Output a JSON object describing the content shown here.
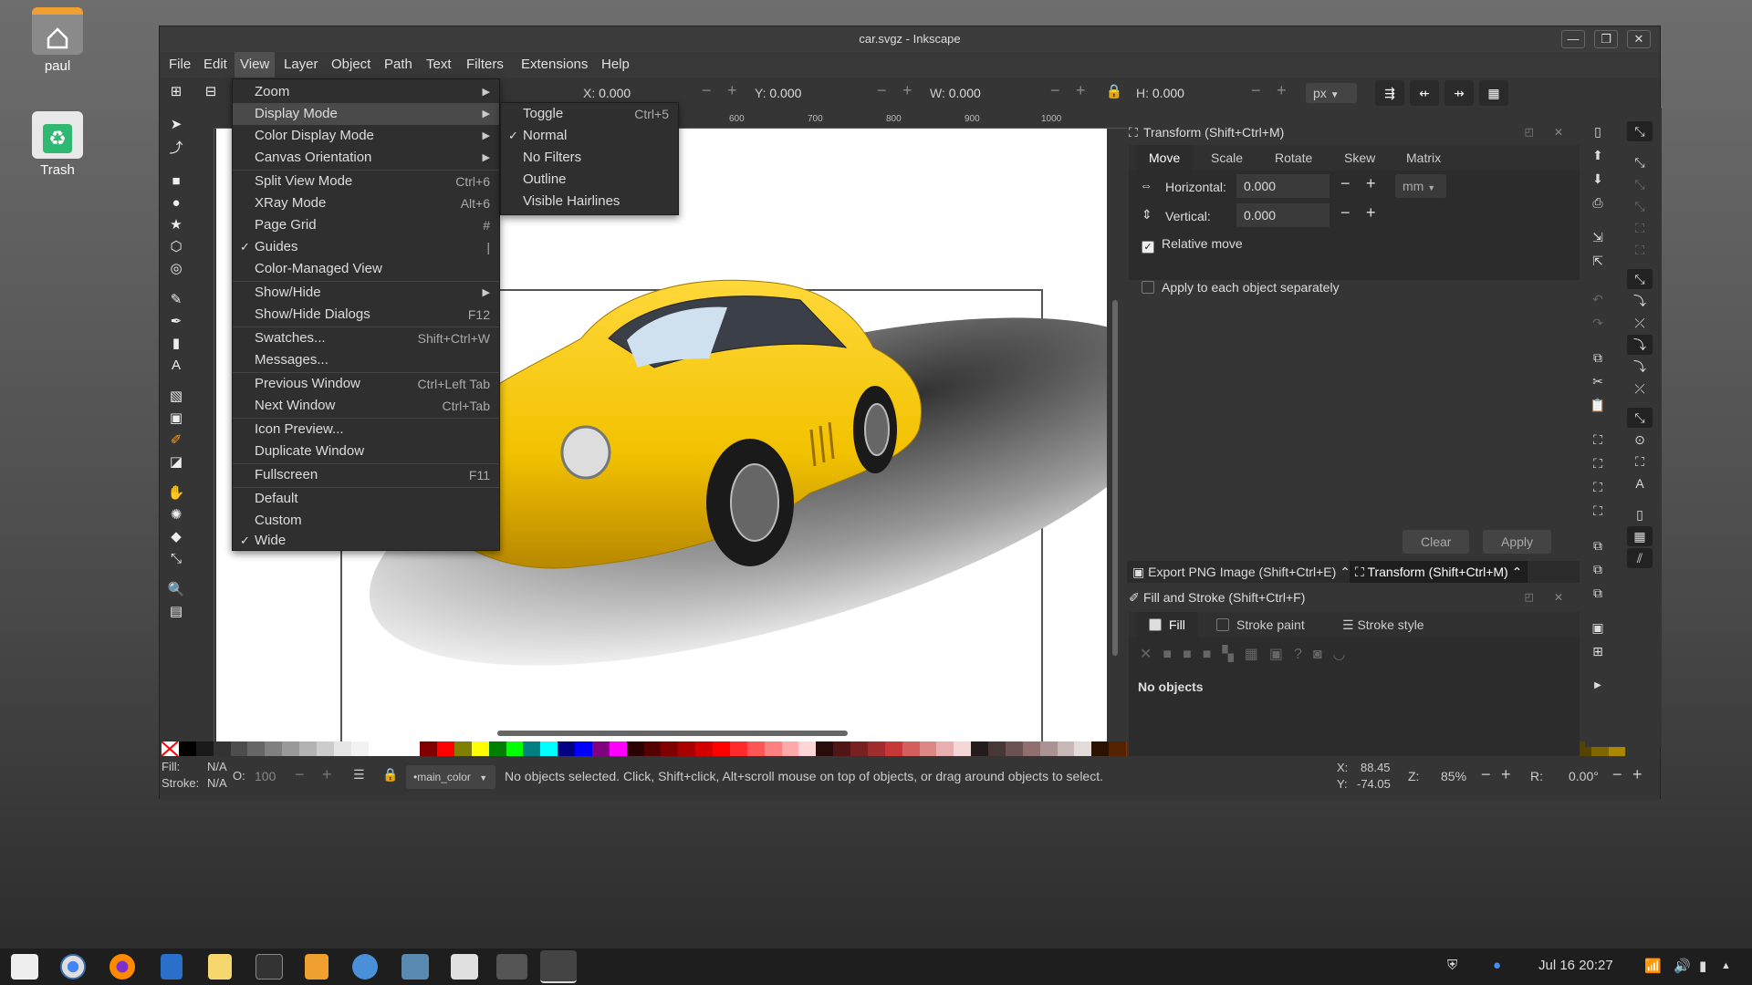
{
  "desktop": {
    "icons": [
      {
        "label": "paul",
        "icon": "home-folder-icon"
      },
      {
        "label": "Trash",
        "icon": "trash-icon"
      }
    ]
  },
  "window": {
    "title": "car.svgz - Inkscape",
    "controls": {
      "minimize": "—",
      "restore": "❐",
      "close": "✕"
    }
  },
  "menubar": [
    "File",
    "Edit",
    "View",
    "Layer",
    "Object",
    "Path",
    "Text",
    "Filters",
    "Extensions",
    "Help"
  ],
  "toolbar": {
    "x_label": "X:",
    "x_value": "0.000",
    "y_label": "Y:",
    "y_value": "0.000",
    "w_label": "W:",
    "w_value": "0.000",
    "h_label": "H:",
    "h_value": "0.000",
    "unit": "px"
  },
  "ruler_ticks": [
    "600",
    "700",
    "800",
    "900",
    "1000"
  ],
  "view_menu": [
    {
      "label": "Zoom",
      "submenu": true
    },
    {
      "label": "Display Mode",
      "submenu": true,
      "highlight": true
    },
    {
      "label": "Color Display Mode",
      "submenu": true
    },
    {
      "label": "Canvas Orientation",
      "submenu": true,
      "sep_after": true
    },
    {
      "label": "Split View Mode",
      "shortcut": "Ctrl+6"
    },
    {
      "label": "XRay Mode",
      "shortcut": "Alt+6"
    },
    {
      "label": "Page Grid",
      "shortcut": "#"
    },
    {
      "label": "Guides",
      "shortcut": "|",
      "checked": true
    },
    {
      "label": "Color-Managed View",
      "sep_after": true
    },
    {
      "label": "Show/Hide",
      "submenu": true
    },
    {
      "label": "Show/Hide Dialogs",
      "shortcut": "F12",
      "sep_after": true
    },
    {
      "label": "Swatches...",
      "shortcut": "Shift+Ctrl+W"
    },
    {
      "label": "Messages...",
      "sep_after": true
    },
    {
      "label": "Previous Window",
      "shortcut": "Ctrl+Left Tab"
    },
    {
      "label": "Next Window",
      "shortcut": "Ctrl+Tab",
      "sep_after": true
    },
    {
      "label": "Icon Preview..."
    },
    {
      "label": "Duplicate Window",
      "sep_after": true
    },
    {
      "label": "Fullscreen",
      "shortcut": "F11",
      "sep_after": true
    },
    {
      "label": "Default"
    },
    {
      "label": "Custom"
    },
    {
      "label": "Wide",
      "checked": true
    }
  ],
  "display_mode_menu": [
    {
      "label": "Toggle",
      "shortcut": "Ctrl+5"
    },
    {
      "label": "Normal",
      "checked": true
    },
    {
      "label": "No Filters"
    },
    {
      "label": "Outline"
    },
    {
      "label": "Visible Hairlines"
    }
  ],
  "transform_panel": {
    "title": "Transform (Shift+Ctrl+M)",
    "tabs": [
      "Move",
      "Scale",
      "Rotate",
      "Skew",
      "Matrix"
    ],
    "horizontal_label": "Horizontal:",
    "horizontal_value": "0.000",
    "vertical_label": "Vertical:",
    "vertical_value": "0.000",
    "unit": "mm",
    "relative_move": "Relative move",
    "apply_each": "Apply to each object separately",
    "clear": "Clear",
    "apply": "Apply"
  },
  "dock_tabs": [
    "Export PNG Image (Shift+Ctrl+E)",
    "Transform (Shift+Ctrl+M)"
  ],
  "fill_stroke_panel": {
    "title": "Fill and Stroke (Shift+Ctrl+F)",
    "tabs": [
      "Fill",
      "Stroke paint",
      "Stroke style"
    ],
    "message": "No objects"
  },
  "statusbar": {
    "fill_label": "Fill:",
    "fill_value": "N/A",
    "stroke_label": "Stroke:",
    "stroke_value": "N/A",
    "opacity_label": "O:",
    "opacity_value": "100",
    "layer": "•main_color",
    "message": "No objects selected. Click, Shift+click, Alt+scroll mouse on top of objects, or drag around objects to select.",
    "x_label": "X:",
    "x_value": "88.45",
    "y_label": "Y:",
    "y_value": "-74.05",
    "zoom_label": "Z:",
    "zoom_value": "85%",
    "rotate_label": "R:",
    "rotate_value": "0.00°"
  },
  "taskbar": {
    "datetime": "Jul 16  20:27"
  },
  "colors": {
    "car_yellow": "#f2c200",
    "accent": "#4a4a4a"
  }
}
